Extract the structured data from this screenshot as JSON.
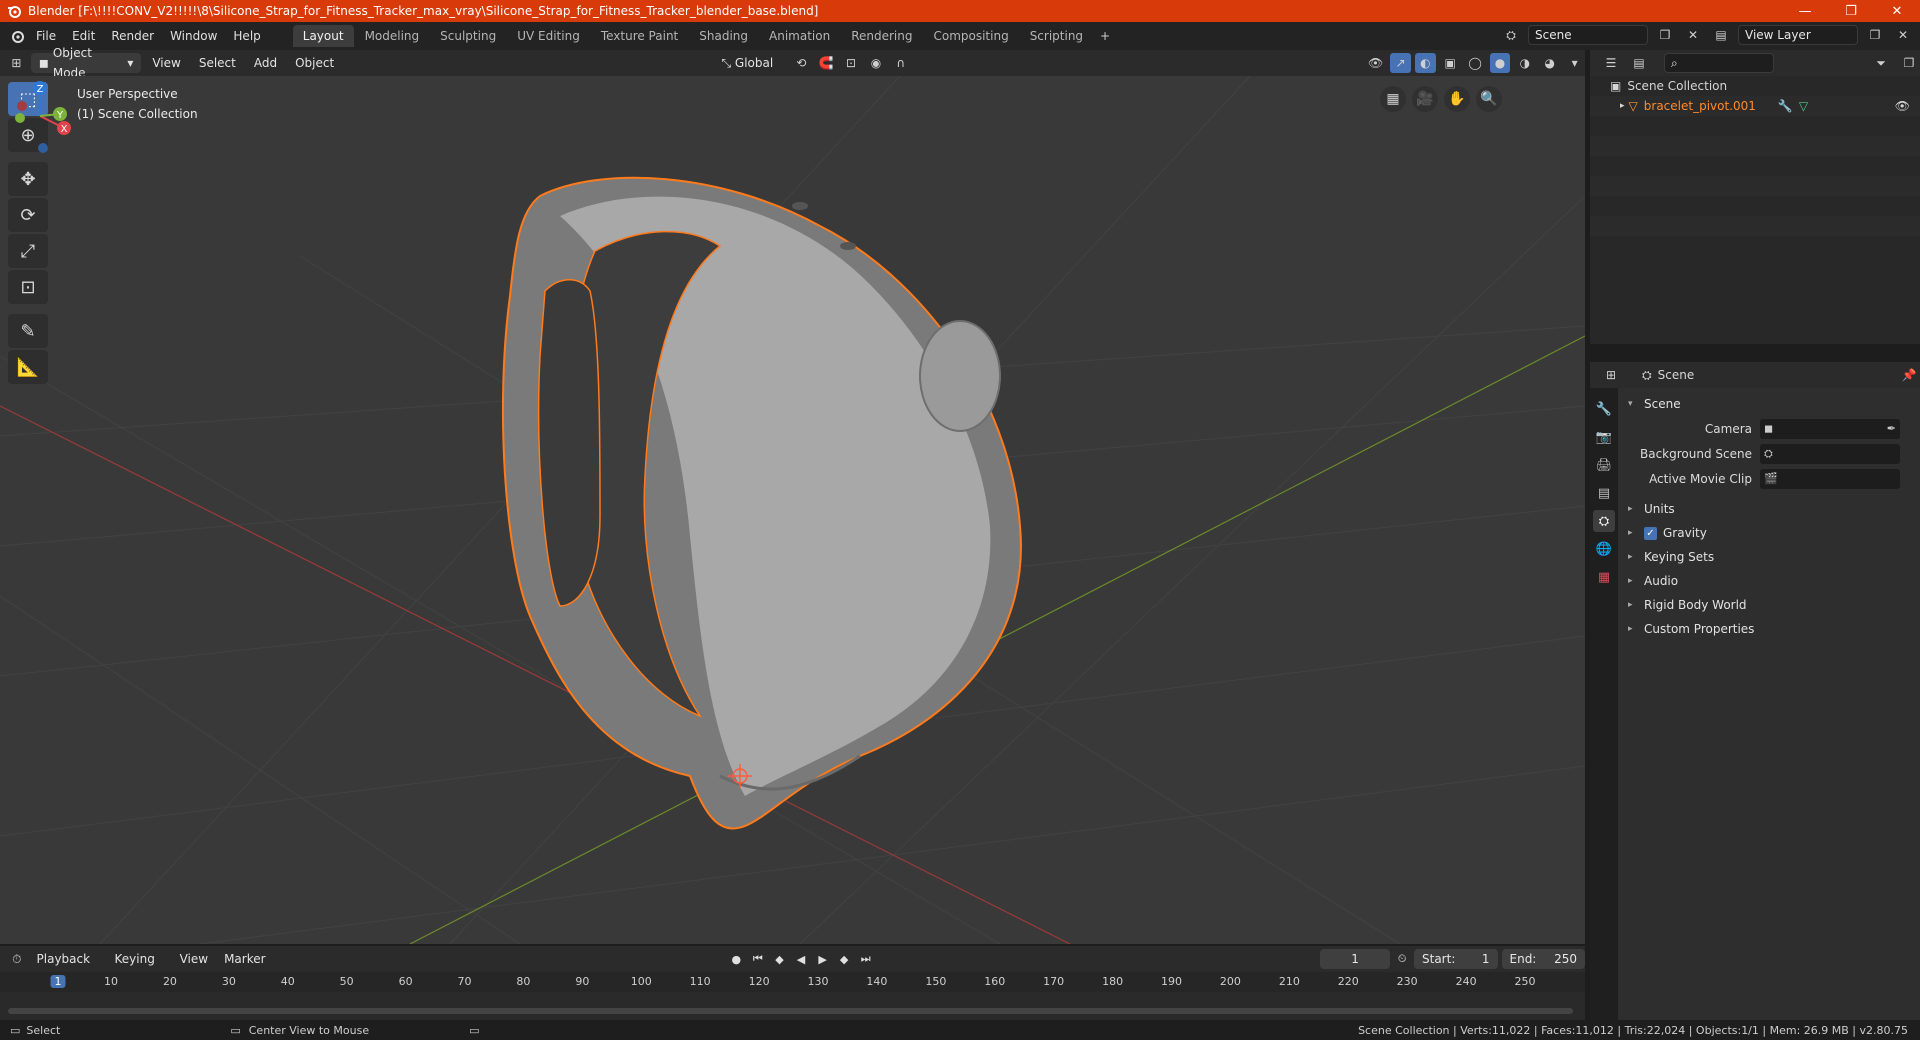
{
  "titlebar": {
    "title": "Blender [F:\\!!!!CONV_V2!!!!!\\8\\Silicone_Strap_for_Fitness_Tracker_max_vray\\Silicone_Strap_for_Fitness_Tracker_blender_base.blend]",
    "minimize": "—",
    "restore": "❐",
    "close": "✕"
  },
  "menu": [
    "File",
    "Edit",
    "Render",
    "Window",
    "Help"
  ],
  "workspaces": [
    "Layout",
    "Modeling",
    "Sculpting",
    "UV Editing",
    "Texture Paint",
    "Shading",
    "Animation",
    "Rendering",
    "Compositing",
    "Scripting"
  ],
  "workspace_add": "+",
  "scene_selector": "Scene",
  "view_layer": "View Layer",
  "viewport_header": {
    "mode": "Object Mode",
    "menus": [
      "View",
      "Select",
      "Add",
      "Object"
    ],
    "orientation": "Global"
  },
  "viewport": {
    "perspective": "User Perspective",
    "collection": "(1) Scene Collection",
    "gizmo": {
      "z": "Z",
      "y": "Y",
      "x": "X"
    }
  },
  "outliner": {
    "root": "Scene Collection",
    "object": "bracelet_pivot.001"
  },
  "properties": {
    "header": "Scene",
    "section": "Scene",
    "rows": [
      {
        "label": "Camera"
      },
      {
        "label": "Background Scene"
      },
      {
        "label": "Active Movie Clip"
      }
    ],
    "panels": [
      "Units",
      "Gravity",
      "Keying Sets",
      "Audio",
      "Rigid Body World",
      "Custom Properties"
    ]
  },
  "timeline": {
    "menus": [
      "Playback",
      "Keying",
      "View",
      "Marker"
    ],
    "current_frame": "1",
    "start_label": "Start:",
    "start": "1",
    "end_label": "End:",
    "end": "250",
    "ticks": [
      "1",
      "10",
      "20",
      "30",
      "40",
      "50",
      "60",
      "70",
      "80",
      "90",
      "100",
      "110",
      "120",
      "130",
      "140",
      "150",
      "160",
      "170",
      "180",
      "190",
      "200",
      "210",
      "220",
      "230",
      "240",
      "250"
    ]
  },
  "status": {
    "left": "Select",
    "middle": "Center View to Mouse",
    "right": "Scene Collection | Verts:11,022 | Faces:11,012 | Tris:22,024 | Objects:1/1 | Mem: 26.9 MB | v2.80.75"
  },
  "colors": {
    "accent": "#4772b3",
    "title": "#d93a09",
    "selection": "#ff7a1a"
  }
}
